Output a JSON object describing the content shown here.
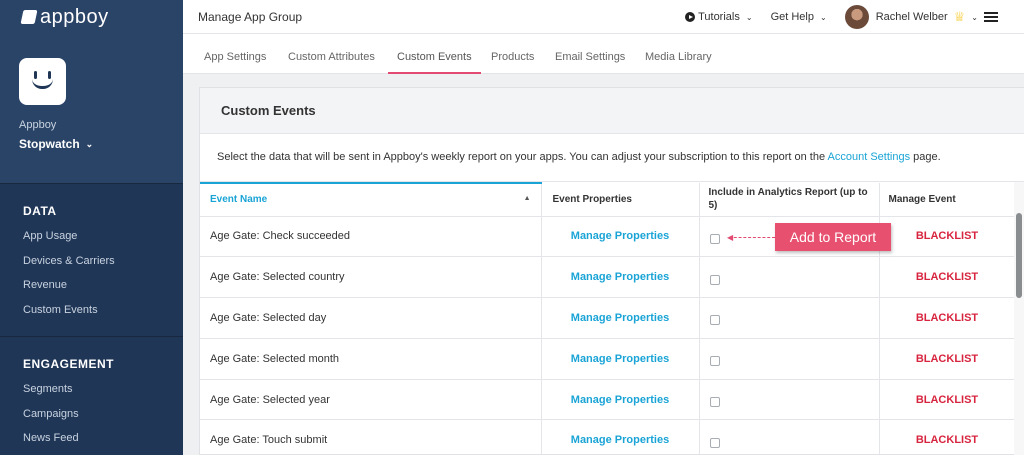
{
  "brand": {
    "name": "appboy",
    "accent": "#e24a72",
    "link": "#1aa4d6",
    "danger": "#d8253f"
  },
  "sidebar": {
    "company": "Appboy",
    "app_name": "Stopwatch",
    "data_title": "DATA",
    "data_items": [
      "App Usage",
      "Devices & Carriers",
      "Revenue",
      "Custom Events"
    ],
    "engagement_title": "ENGAGEMENT",
    "engagement_items": [
      "Segments",
      "Campaigns",
      "News Feed"
    ]
  },
  "header": {
    "title": "Manage App Group",
    "tutorials": "Tutorials",
    "help": "Get Help",
    "user": "Rachel Welber"
  },
  "tabs": [
    "App Settings",
    "Custom Attributes",
    "Custom Events",
    "Products",
    "Email Settings",
    "Media Library"
  ],
  "card": {
    "title": "Custom Events",
    "desc_before": "Select the data that will be sent in Appboy's weekly report on your apps. You can adjust your subscription to this report on the ",
    "desc_link": "Account Settings",
    "desc_after": " page."
  },
  "table": {
    "headers": [
      "Event Name",
      "Event Properties",
      "Include in Analytics Report (up to 5)",
      "Manage Event"
    ],
    "rows": [
      {
        "name": "Age Gate: Check succeeded",
        "props": "Manage Properties",
        "manage": "BLACKLIST"
      },
      {
        "name": "Age Gate: Selected country",
        "props": "Manage Properties",
        "manage": "BLACKLIST"
      },
      {
        "name": "Age Gate: Selected day",
        "props": "Manage Properties",
        "manage": "BLACKLIST"
      },
      {
        "name": "Age Gate: Selected month",
        "props": "Manage Properties",
        "manage": "BLACKLIST"
      },
      {
        "name": "Age Gate: Selected year",
        "props": "Manage Properties",
        "manage": "BLACKLIST"
      },
      {
        "name": "Age Gate: Touch submit",
        "props": "Manage Properties",
        "manage": "BLACKLIST"
      }
    ]
  },
  "callout": {
    "label": "Add to Report"
  },
  "icons": [
    "logo-icon",
    "app-smiley-icon",
    "chevron-down-icon",
    "play-icon",
    "crown-icon",
    "hamburger-icon",
    "sort-up-icon"
  ]
}
